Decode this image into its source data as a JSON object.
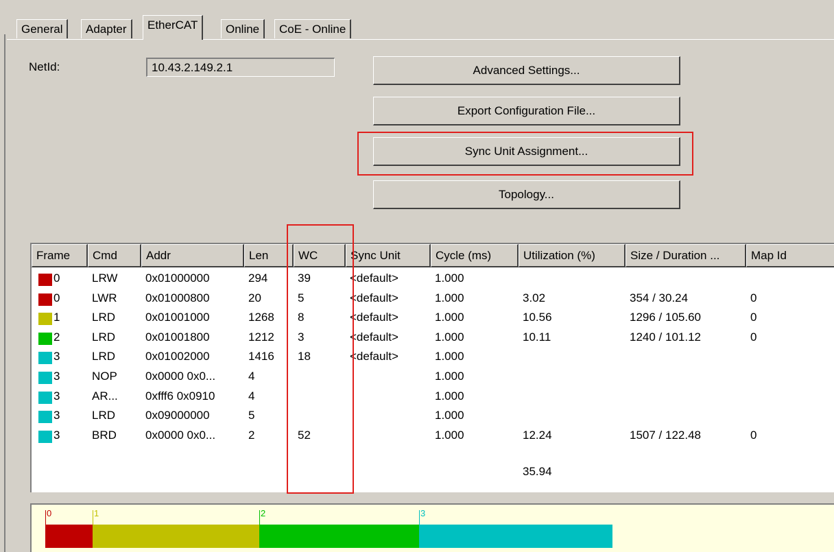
{
  "tabs": [
    {
      "label": "General",
      "active": false
    },
    {
      "label": "Adapter",
      "active": false
    },
    {
      "label": "EtherCAT",
      "active": true
    },
    {
      "label": "Online",
      "active": false
    },
    {
      "label": "CoE - Online",
      "active": false
    }
  ],
  "netid": {
    "label": "NetId:",
    "value": "10.43.2.149.2.1"
  },
  "buttons": {
    "advanced": "Advanced Settings...",
    "export": "Export Configuration File...",
    "sync": "Sync Unit Assignment...",
    "topology": "Topology..."
  },
  "table": {
    "columns": [
      "Frame",
      "Cmd",
      "Addr",
      "Len",
      "WC",
      "Sync Unit",
      "Cycle (ms)",
      "Utilization (%)",
      "Size / Duration ...",
      "Map Id"
    ],
    "rows": [
      {
        "color": "#c00000",
        "frame": "0",
        "cmd": "LRW",
        "addr": "0x01000000",
        "len": "294",
        "wc": "39",
        "sync": "<default>",
        "cycle": "1.000",
        "util": "",
        "size": "",
        "map": ""
      },
      {
        "color": "#c00000",
        "frame": "0",
        "cmd": "LWR",
        "addr": "0x01000800",
        "len": "20",
        "wc": "5",
        "sync": "<default>",
        "cycle": "1.000",
        "util": "3.02",
        "size": "354 / 30.24",
        "map": "0"
      },
      {
        "color": "#c0c000",
        "frame": "1",
        "cmd": "LRD",
        "addr": "0x01001000",
        "len": "1268",
        "wc": "8",
        "sync": "<default>",
        "cycle": "1.000",
        "util": "10.56",
        "size": "1296 / 105.60",
        "map": "0"
      },
      {
        "color": "#00c000",
        "frame": "2",
        "cmd": "LRD",
        "addr": "0x01001800",
        "len": "1212",
        "wc": "3",
        "sync": "<default>",
        "cycle": "1.000",
        "util": "10.11",
        "size": "1240 / 101.12",
        "map": "0"
      },
      {
        "color": "#00c0c0",
        "frame": "3",
        "cmd": "LRD",
        "addr": "0x01002000",
        "len": "1416",
        "wc": "18",
        "sync": "<default>",
        "cycle": "1.000",
        "util": "",
        "size": "",
        "map": ""
      },
      {
        "color": "#00c0c0",
        "frame": "3",
        "cmd": "NOP",
        "addr": "0x0000 0x0...",
        "len": "4",
        "wc": "",
        "sync": "",
        "cycle": "1.000",
        "util": "",
        "size": "",
        "map": ""
      },
      {
        "color": "#00c0c0",
        "frame": "3",
        "cmd": "AR...",
        "addr": "0xfff6 0x0910",
        "len": "4",
        "wc": "",
        "sync": "",
        "cycle": "1.000",
        "util": "",
        "size": "",
        "map": ""
      },
      {
        "color": "#00c0c0",
        "frame": "3",
        "cmd": "LRD",
        "addr": "0x09000000",
        "len": "5",
        "wc": "",
        "sync": "",
        "cycle": "1.000",
        "util": "",
        "size": "",
        "map": ""
      },
      {
        "color": "#00c0c0",
        "frame": "3",
        "cmd": "BRD",
        "addr": "0x0000 0x0...",
        "len": "2",
        "wc": "52",
        "sync": "",
        "cycle": "1.000",
        "util": "12.24",
        "size": "1507 / 122.48",
        "map": "0"
      }
    ],
    "total_utilization": "35.94"
  },
  "frame_bar": [
    {
      "label": "0",
      "color": "#c00000",
      "share": 0.0302
    },
    {
      "label": "1",
      "color": "#c0c000",
      "share": 0.1056
    },
    {
      "label": "2",
      "color": "#00c000",
      "share": 0.1011
    },
    {
      "label": "3",
      "color": "#00c0c0",
      "share": 0.1224
    }
  ],
  "highlight_color": "#e0201d"
}
